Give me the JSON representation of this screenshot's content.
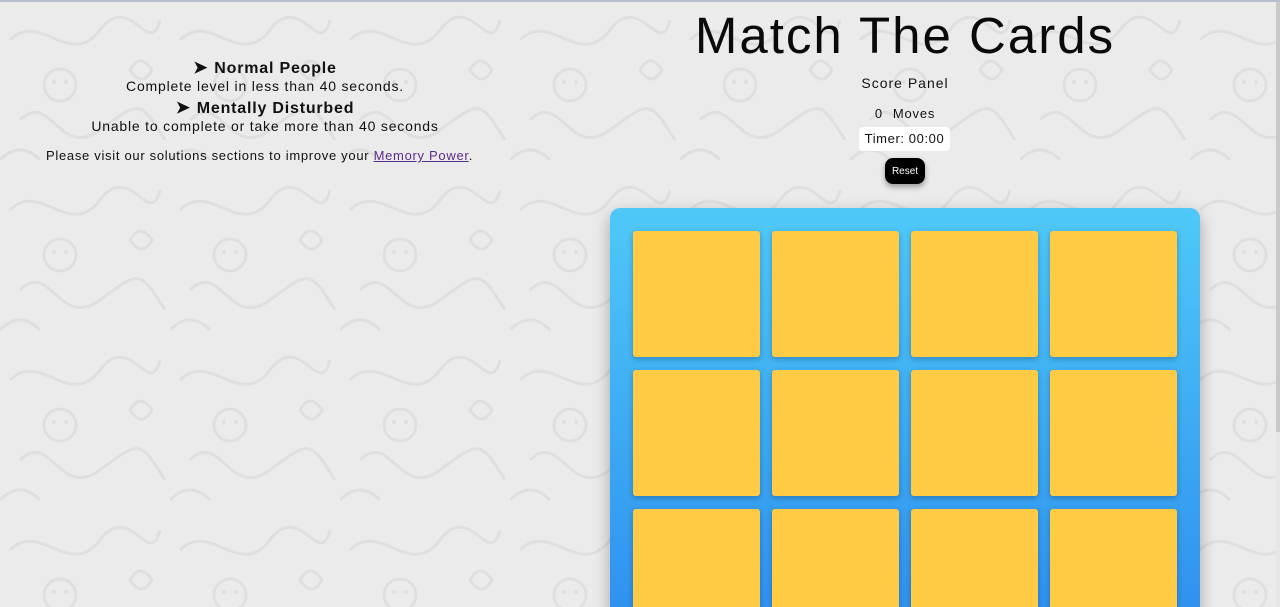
{
  "page": {
    "title": "Match The Cards"
  },
  "info": {
    "levels": [
      {
        "arrow": "➤",
        "heading": "Normal People",
        "description": "Complete level in less than 40 seconds."
      },
      {
        "arrow": "➤",
        "heading": "Mentally Disturbed",
        "description": "Unable to complete or take more than 40 seconds"
      }
    ],
    "visit_text": "Please visit our solutions sections to improve your ",
    "visit_link": "Memory Power",
    "visit_end": "."
  },
  "score_panel": {
    "label": "Score Panel",
    "moves_count": "0",
    "moves_label": "Moves",
    "timer": "Timer: 00:00",
    "reset_label": "Reset"
  },
  "deck": {
    "card_color": "#ffcb45",
    "background_colors": [
      "#4fc9f8",
      "#2f8ff0"
    ],
    "visible_cards": 12
  }
}
